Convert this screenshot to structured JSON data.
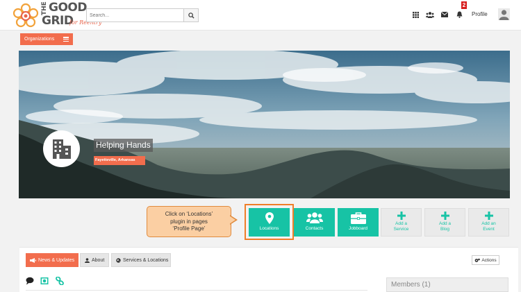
{
  "brand": {
    "the": "THE",
    "good": "GOOD",
    "grid": "GRID",
    "tagline": "for Reentry",
    "accent": "#f26d4d"
  },
  "search": {
    "placeholder": "Search..."
  },
  "nav": {
    "icons": [
      "apps-grid-icon",
      "users-icon",
      "envelope-icon",
      "bell-icon"
    ],
    "notification_count": "2",
    "profile_label": "Profile"
  },
  "organizations": {
    "label": "Organizations"
  },
  "org": {
    "name": "Helping Hands",
    "location": "Fayetteville, Arkansas"
  },
  "callout": {
    "line1": "Click on ‘Locations’",
    "line2": "plugin in pages",
    "line3": "‘Profile Page’"
  },
  "plugins": [
    {
      "label": "Locations",
      "icon": "map-marker-icon"
    },
    {
      "label": "Contacts",
      "icon": "users-icon"
    },
    {
      "label": "Jobboard",
      "icon": "briefcase-icon"
    },
    {
      "label1": "Add a",
      "label2": "Service",
      "icon": "plus-icon"
    },
    {
      "label1": "Add a",
      "label2": "Blog",
      "icon": "plus-icon"
    },
    {
      "label1": "Add an",
      "label2": "Event",
      "icon": "plus-icon"
    }
  ],
  "tabs": [
    {
      "label": "News & Updates"
    },
    {
      "label": "About"
    },
    {
      "label": "Services & Locations"
    }
  ],
  "actions_label": "Actions",
  "members_label": "Members (1)",
  "colors": {
    "teal": "#17c3a5",
    "orange": "#f26d4d",
    "highlight": "#f07e28"
  }
}
